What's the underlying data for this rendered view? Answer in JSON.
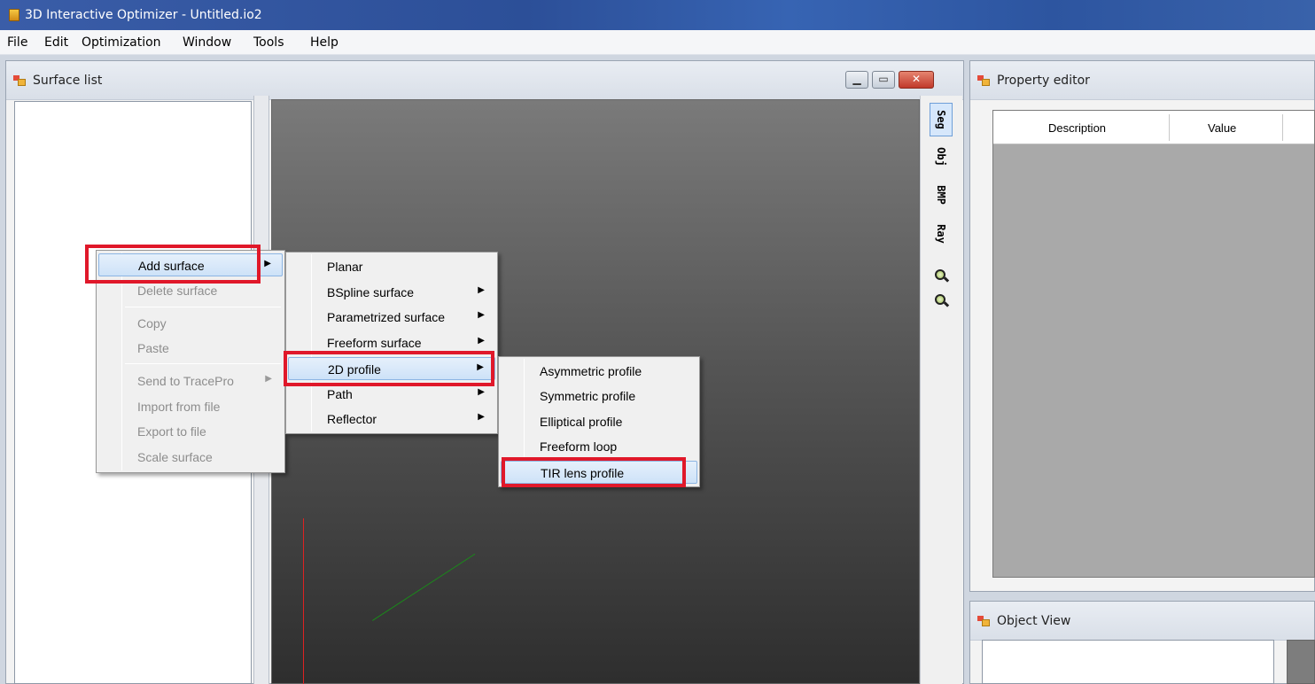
{
  "window": {
    "title": "3D Interactive Optimizer - Untitled.io2"
  },
  "menubar": [
    "File",
    "Edit",
    "Optimization",
    "Window",
    "Tools",
    "Help"
  ],
  "panels": {
    "surface_list": "Surface list",
    "property_editor": "Property editor",
    "object_view": "Object View"
  },
  "viewer_toolbar": {
    "tabs": [
      "Seg",
      "Obj",
      "BMP",
      "Ray"
    ],
    "zoom_in": "zoom-in-icon",
    "zoom_extents": "zoom-extents-icon"
  },
  "property_grid": {
    "columns": [
      "Description",
      "Value"
    ]
  },
  "context_menu": {
    "items": [
      {
        "label": "Add surface",
        "disabled": false,
        "submenu": true,
        "highlighted": true
      },
      {
        "label": "Delete surface",
        "disabled": true
      },
      {
        "label": "Copy",
        "disabled": true
      },
      {
        "label": "Paste",
        "disabled": true
      },
      {
        "label": "Send to TracePro",
        "disabled": true,
        "submenu": true
      },
      {
        "label": "Import from file",
        "disabled": true
      },
      {
        "label": "Export to file",
        "disabled": true
      },
      {
        "label": "Scale surface",
        "disabled": true
      }
    ]
  },
  "add_surface_menu": {
    "items": [
      "Planar",
      "BSpline surface",
      "Parametrized surface",
      "Freeform surface",
      "2D profile",
      "Path",
      "Reflector"
    ],
    "highlighted": "2D profile"
  },
  "profile_menu": {
    "items": [
      "Asymmetric profile",
      "Symmetric profile",
      "Elliptical profile",
      "Freeform loop",
      "TIR lens profile"
    ],
    "highlighted": "TIR lens profile"
  },
  "colors": {
    "highlight_box": "#e0182a",
    "titlebar": "#2c4f98"
  }
}
